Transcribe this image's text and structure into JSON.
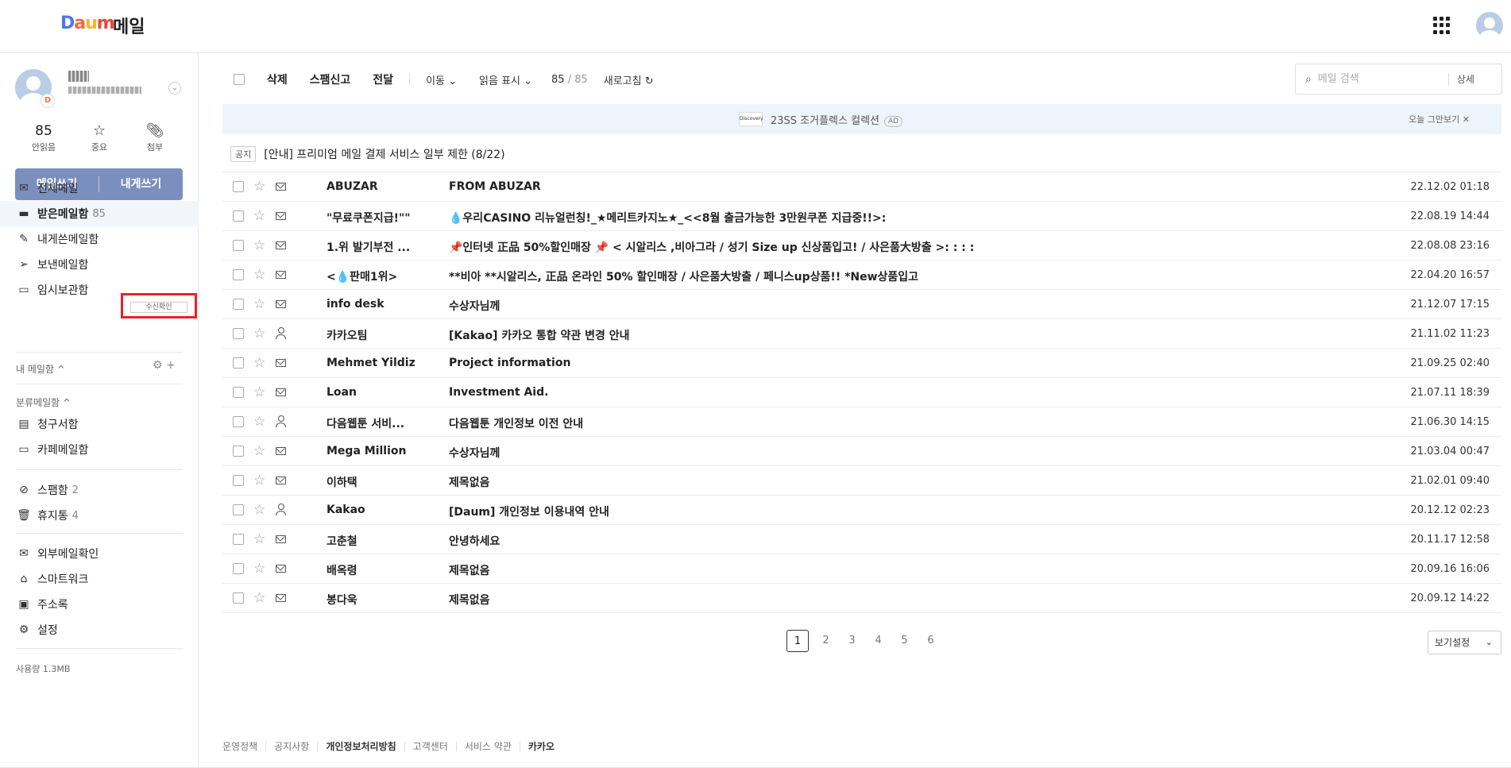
{
  "header": {
    "logo": [
      "D",
      "a",
      "u",
      "m"
    ],
    "app_name": "메일"
  },
  "profile": {
    "badge": "D"
  },
  "stats": [
    {
      "value": "85",
      "label": "안읽음"
    },
    {
      "icon": "star-icon",
      "label": "중요"
    },
    {
      "icon": "paperclip-icon",
      "label": "첨부"
    }
  ],
  "compose": {
    "write": "메일쓰기",
    "write_to_self": "내게쓰기"
  },
  "nav": {
    "all": "전체메일",
    "inbox": "받은메일함",
    "inbox_count": "85",
    "to_self": "내게쓴메일함",
    "sent": "보낸메일함",
    "read_receipt": "수신확인",
    "drafts": "임시보관함",
    "my_folders": "내 메일함 ^",
    "categories": "분류메일함 ^",
    "bills": "청구서함",
    "cafe": "카페메일함",
    "spam": "스팸함",
    "spam_count": "2",
    "trash": "휴지통",
    "trash_count": "4",
    "external": "외부메일확인",
    "smartwork": "스마트워크",
    "contacts": "주소록",
    "settings": "설정"
  },
  "usage": "사용량 1.3MB",
  "toolbar": {
    "delete": "삭제",
    "report_spam": "스팸신고",
    "forward": "전달",
    "move": "이동 ⌄",
    "mark_read": "읽음 표시 ⌄",
    "count_current": "85",
    "count_sep": " / ",
    "count_total": "85",
    "refresh": "새로고침 ↻"
  },
  "search": {
    "placeholder": "메일 검색",
    "detail": "상세"
  },
  "ad": {
    "logo": "Discovery",
    "text": "23SS 조거플렉스 컬렉션",
    "badge": "AD",
    "close": "오늘 그만보기 ✕"
  },
  "notice": {
    "badge": "공지",
    "text": "[안내] 프리미엄 메일 결제 서비스 일부 제한 (8/22)"
  },
  "emails": [
    {
      "type": "envelope-icon",
      "from": "ABUZAR",
      "subject": "FROM ABUZAR",
      "date": "22.12.02 01:18"
    },
    {
      "type": "envelope-icon",
      "from": "\"무료쿠폰지급!\"\"",
      "subject": "💧우리CASINO 리뉴얼런칭!_★메리트카지노★_<<8월 출금가능한 3만원쿠폰 지급중!!>:",
      "date": "22.08.19 14:44"
    },
    {
      "type": "envelope-icon",
      "from": "1.위 발기부전 ...",
      "subject": "📌인터넷 正品 50%할인매장 📌 < 시알리스 ,비아그라 / 성기 Size up 신상품입고! / 사은품大방출 >: : : :",
      "date": "22.08.08 23:16"
    },
    {
      "type": "envelope-icon",
      "from": "<💧판매1위>",
      "subject": "**비아 **시알리스, 正品 온라인 50% 할인매장 /   사은품大방출   /    페니스up상품!! *New상품입고",
      "date": "22.04.20 16:57"
    },
    {
      "type": "envelope-icon",
      "from": "info desk",
      "subject": "수상자님께",
      "date": "21.12.07 17:15"
    },
    {
      "type": "person-icon",
      "from": "카카오팀",
      "subject": "[Kakao] 카카오 통합 약관 변경 안내",
      "date": "21.11.02 11:23"
    },
    {
      "type": "envelope-icon",
      "from": "Mehmet Yildiz",
      "subject": "Project information",
      "date": "21.09.25 02:40"
    },
    {
      "type": "envelope-icon",
      "from": "Loan",
      "subject": "Investment Aid.",
      "date": "21.07.11 18:39"
    },
    {
      "type": "person-icon",
      "from": "다음웹툰 서비...",
      "subject": "다음웹툰 개인정보 이전 안내",
      "date": "21.06.30 14:15"
    },
    {
      "type": "envelope-icon",
      "from": "Mega Million",
      "subject": "수상자님께",
      "date": "21.03.04 00:47"
    },
    {
      "type": "envelope-icon",
      "from": "이하택",
      "subject": "제목없음",
      "date": "21.02.01 09:40"
    },
    {
      "type": "person-icon",
      "from": "Kakao",
      "subject": "[Daum] 개인정보 이용내역 안내",
      "date": "20.12.12 02:23"
    },
    {
      "type": "envelope-icon",
      "from": "고춘철",
      "subject": "안녕하세요",
      "date": "20.11.17 12:58"
    },
    {
      "type": "envelope-icon",
      "from": "배옥령",
      "subject": "제목없음",
      "date": "20.09.16 16:06"
    },
    {
      "type": "envelope-icon",
      "from": "봉다욱",
      "subject": "제목없음",
      "date": "20.09.12 14:22"
    }
  ],
  "pagination": {
    "pages": [
      "1",
      "2",
      "3",
      "4",
      "5",
      "6"
    ],
    "current": "1"
  },
  "view_setting": "보기설정",
  "footer": [
    "운영정책",
    "공지사항",
    "개인정보처리방침",
    "고객센터",
    "서비스 약관",
    "카카오"
  ]
}
